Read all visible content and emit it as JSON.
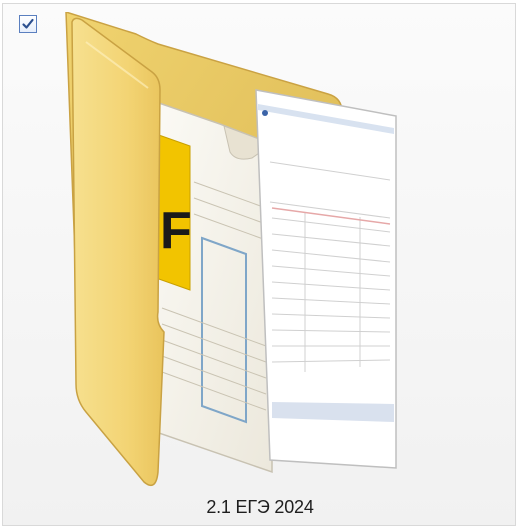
{
  "item": {
    "name": "2.1 ЕГЭ 2024",
    "checked": true,
    "icon": "folder-icon",
    "preview_contents": [
      "pdf-document-icon",
      "scanned-form-page-icon"
    ]
  },
  "colors": {
    "folder_front": "#f3d77c",
    "folder_back": "#e7c55a",
    "pdf_accent": "#f2c400",
    "selection_border": "#d9d9d9"
  }
}
